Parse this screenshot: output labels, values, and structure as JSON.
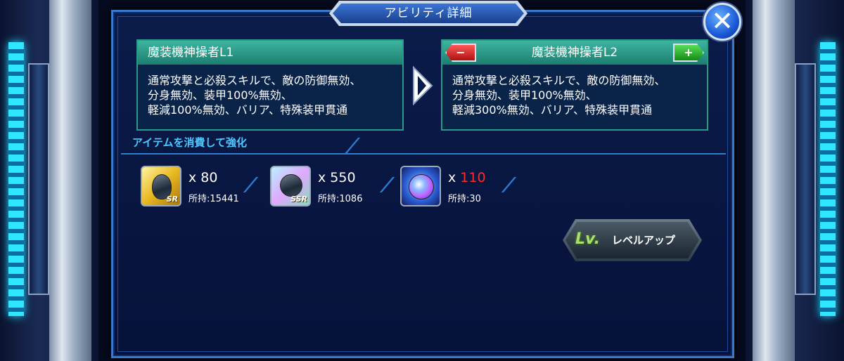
{
  "dialog": {
    "title": "アビリティ詳細",
    "close_icon": "close-icon",
    "close_glyph": "✕"
  },
  "ability": {
    "current": {
      "name": "魔装機神操者L1",
      "desc_lines": [
        "通常攻撃と必殺スキルで、敵の防御無効、",
        "分身無効、装甲100%無効、",
        "軽減100%無効、バリア、特殊装甲貫通"
      ]
    },
    "next": {
      "name": "魔装機神操者L2",
      "minus_label": "−",
      "plus_label": "+",
      "desc_lines": [
        "通常攻撃と必殺スキルで、敵の防御無効、",
        "分身無効、装甲100%無効、",
        "軽減300%無効、バリア、特殊装甲貫通"
      ]
    }
  },
  "enhance": {
    "label": "アイテムを消費して強化",
    "items": [
      {
        "icon": "sr-gem-icon",
        "rarity": "SR",
        "prefix": "x ",
        "need": "80",
        "owned": "所持:15441",
        "insufficient": false
      },
      {
        "icon": "ssr-gem-icon",
        "rarity": "SSR",
        "prefix": "x ",
        "need": "550",
        "owned": "所持:1086",
        "insufficient": false
      },
      {
        "icon": "orb-icon",
        "rarity": "",
        "prefix": "x ",
        "need": "110",
        "owned": "所持:30",
        "insufficient": true
      }
    ]
  },
  "levelup": {
    "icon_text": "Lv.",
    "label": "レベルアップ"
  },
  "colors": {
    "panel_border": "#2a9a86",
    "header": "#3db5a0",
    "accent": "#4ec8ff",
    "warn": "#ff2a2a"
  }
}
